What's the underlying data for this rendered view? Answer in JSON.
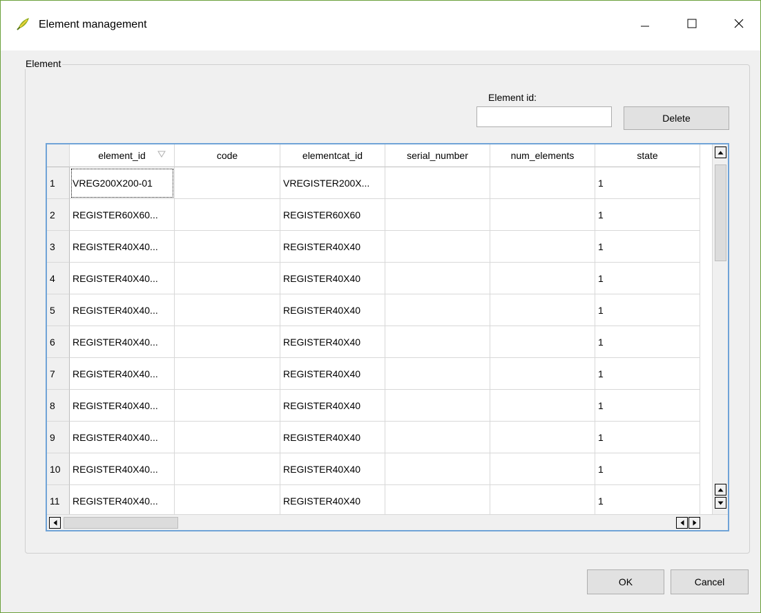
{
  "window": {
    "title": "Element management",
    "accent_color": "#6a9f3a"
  },
  "group": {
    "label": "Element",
    "element_id_label": "Element id:",
    "element_id_value": "",
    "delete_label": "Delete"
  },
  "table": {
    "columns": [
      "element_id",
      "code",
      "elementcat_id",
      "serial_number",
      "num_elements",
      "state"
    ],
    "sorted_column": "element_id",
    "rows": [
      {
        "num": "1",
        "element_id": "VREG200X200-01",
        "code": "",
        "elementcat_id": "VREGISTER200X...",
        "serial_number": "",
        "num_elements": "",
        "state": "1"
      },
      {
        "num": "2",
        "element_id": "REGISTER60X60...",
        "code": "",
        "elementcat_id": "REGISTER60X60",
        "serial_number": "",
        "num_elements": "",
        "state": "1"
      },
      {
        "num": "3",
        "element_id": "REGISTER40X40...",
        "code": "",
        "elementcat_id": "REGISTER40X40",
        "serial_number": "",
        "num_elements": "",
        "state": "1"
      },
      {
        "num": "4",
        "element_id": "REGISTER40X40...",
        "code": "",
        "elementcat_id": "REGISTER40X40",
        "serial_number": "",
        "num_elements": "",
        "state": "1"
      },
      {
        "num": "5",
        "element_id": "REGISTER40X40...",
        "code": "",
        "elementcat_id": "REGISTER40X40",
        "serial_number": "",
        "num_elements": "",
        "state": "1"
      },
      {
        "num": "6",
        "element_id": "REGISTER40X40...",
        "code": "",
        "elementcat_id": "REGISTER40X40",
        "serial_number": "",
        "num_elements": "",
        "state": "1"
      },
      {
        "num": "7",
        "element_id": "REGISTER40X40...",
        "code": "",
        "elementcat_id": "REGISTER40X40",
        "serial_number": "",
        "num_elements": "",
        "state": "1"
      },
      {
        "num": "8",
        "element_id": "REGISTER40X40...",
        "code": "",
        "elementcat_id": "REGISTER40X40",
        "serial_number": "",
        "num_elements": "",
        "state": "1"
      },
      {
        "num": "9",
        "element_id": "REGISTER40X40...",
        "code": "",
        "elementcat_id": "REGISTER40X40",
        "serial_number": "",
        "num_elements": "",
        "state": "1"
      },
      {
        "num": "10",
        "element_id": "REGISTER40X40...",
        "code": "",
        "elementcat_id": "REGISTER40X40",
        "serial_number": "",
        "num_elements": "",
        "state": "1"
      },
      {
        "num": "11",
        "element_id": "REGISTER40X40...",
        "code": "",
        "elementcat_id": "REGISTER40X40",
        "serial_number": "",
        "num_elements": "",
        "state": "1"
      }
    ]
  },
  "buttons": {
    "ok": "OK",
    "cancel": "Cancel"
  },
  "icons": {
    "app": "qgis-leaf-icon",
    "minimize": "minimize-icon",
    "maximize": "maximize-icon",
    "close": "close-icon",
    "sort": "sort-descending-icon"
  }
}
